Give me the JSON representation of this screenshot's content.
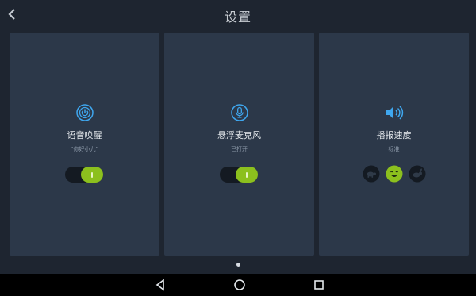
{
  "header": {
    "title": "设置",
    "back_icon": "chevron-left-icon"
  },
  "cards": [
    {
      "title": "语音唤醒",
      "subtitle": "“你好小九”",
      "icon": "power-broadcast-icon",
      "toggle_on": true
    },
    {
      "title": "悬浮麦克风",
      "subtitle": "已打开",
      "icon": "microphone-icon",
      "toggle_on": true
    },
    {
      "title": "播报速度",
      "subtitle": "标准",
      "icon": "speaker-icon",
      "options": [
        "turtle-icon",
        "smiley-icon",
        "rabbit-icon"
      ],
      "selected": "smiley-icon"
    }
  ],
  "pager": {
    "pages": 1,
    "current": 1
  },
  "navbar": [
    "back-triangle-icon",
    "home-circle-icon",
    "recents-square-icon"
  ],
  "colors": {
    "background": "#1e2530",
    "card": "#2c3849",
    "accent": "#3fa7ef",
    "toggle_on": "#8cc01e",
    "selected_face": "#8cc01e"
  }
}
